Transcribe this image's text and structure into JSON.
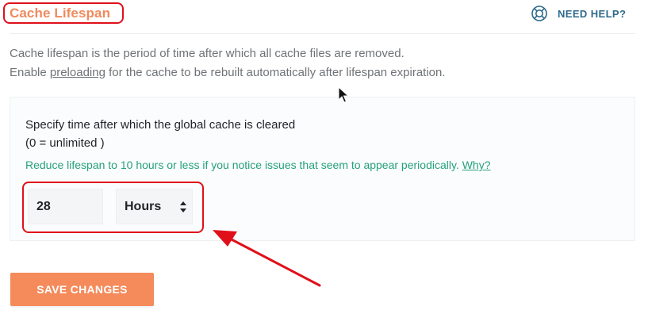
{
  "section": {
    "title": "Cache Lifespan"
  },
  "help": {
    "label": "NEED HELP?",
    "icon": "lifebuoy-icon"
  },
  "description": {
    "line1": "Cache lifespan is the period of time after which all cache files are removed.",
    "line2_before": "Enable ",
    "line2_link": "preloading",
    "line2_after": " for the cache to be rebuilt automatically after lifespan expiration."
  },
  "setting": {
    "label_line1": "Specify time after which the global cache is cleared",
    "label_line2": "(0 = unlimited )",
    "hint": "Reduce lifespan to 10 hours or less if you notice issues that seem to appear periodically.",
    "hint_link": "Why?",
    "value": "28",
    "unit": "Hours"
  },
  "actions": {
    "save_label": "SAVE CHANGES"
  },
  "colors": {
    "accent": "#f58a5a",
    "title": "#f08a5d",
    "hint": "#26a17b",
    "help": "#2d6a8c",
    "annotation": "#e0101a"
  }
}
